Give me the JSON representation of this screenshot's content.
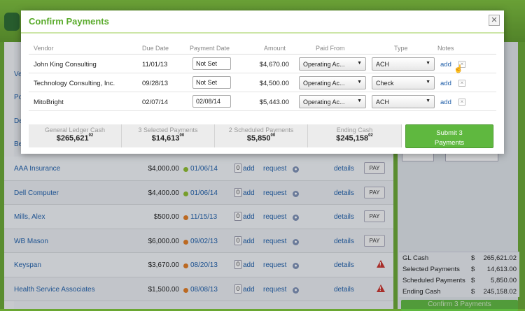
{
  "background": {
    "partial_vendors": [
      "Ve",
      "Po",
      "De",
      "Be"
    ],
    "rows": [
      {
        "vendor": "AAA Insurance",
        "amount": "$4,000.00",
        "status": "green",
        "date": "01/06/14",
        "count": "0",
        "add": "add",
        "request": "request",
        "details": "details",
        "action": "PAY"
      },
      {
        "vendor": "Dell Computer",
        "amount": "$4,400.00",
        "status": "green",
        "date": "01/06/14",
        "count": "0",
        "add": "add",
        "request": "request",
        "details": "details",
        "action": "PAY"
      },
      {
        "vendor": "Mills, Alex",
        "amount": "$500.00",
        "status": "orange",
        "date": "11/15/13",
        "count": "0",
        "add": "add",
        "request": "request",
        "details": "details",
        "action": "PAY"
      },
      {
        "vendor": "WB Mason",
        "amount": "$6,000.00",
        "status": "orange",
        "date": "09/02/13",
        "count": "0",
        "add": "add",
        "request": "request",
        "details": "details",
        "action": "PAY"
      },
      {
        "vendor": "Keyspan",
        "amount": "$3,670.00",
        "status": "orange",
        "date": "08/20/13",
        "count": "0",
        "add": "add",
        "request": "request",
        "details": "details",
        "action": "warning"
      },
      {
        "vendor": "Health Service Associates",
        "amount": "$1,500.00",
        "status": "orange",
        "date": "08/08/13",
        "count": "0",
        "add": "add",
        "request": "request",
        "details": "details",
        "action": "warning"
      }
    ],
    "totals": [
      {
        "label": "GL Cash",
        "currency": "$",
        "value": "265,621.02"
      },
      {
        "label": "Selected Payments",
        "currency": "$",
        "value": "14,613.00"
      },
      {
        "label": "Scheduled Payments",
        "currency": "$",
        "value": "5,850.00"
      },
      {
        "label": "Ending Cash",
        "currency": "$",
        "value": "245,158.02"
      }
    ],
    "confirm_label": "Confirm 3 Payments"
  },
  "modal": {
    "title": "Confirm Payments",
    "close": "✕",
    "headers": {
      "vendor": "Vendor",
      "due_date": "Due Date",
      "payment_date": "Payment Date",
      "amount": "Amount",
      "paid_from": "Paid From",
      "type": "Type",
      "notes": "Notes"
    },
    "rows": [
      {
        "vendor": "John King Consulting",
        "due_date": "11/01/13",
        "payment_date": "Not Set",
        "amount": "$4,670.00",
        "paid_from": "Operating Ac...",
        "type": "ACH",
        "note": "add"
      },
      {
        "vendor": "Technology Consulting, Inc.",
        "due_date": "09/28/13",
        "payment_date": "Not Set",
        "amount": "$4,500.00",
        "paid_from": "Operating Ac...",
        "type": "Check",
        "note": "add"
      },
      {
        "vendor": "MitoBright",
        "due_date": "02/07/14",
        "payment_date": "02/08/14",
        "amount": "$5,443.00",
        "paid_from": "Operating Ac...",
        "type": "ACH",
        "note": "add"
      }
    ],
    "summary": [
      {
        "label": "General Ledger Cash",
        "value": "$265,621",
        "cents": "02"
      },
      {
        "label": "3 Selected Payments",
        "value": "$14,613",
        "cents": "00"
      },
      {
        "label": "2 Scheduled Payments",
        "value": "$5,850",
        "cents": "00"
      },
      {
        "label": "Ending Cash",
        "value": "$245,158",
        "cents": "02"
      }
    ],
    "submit_line1": "Submit 3",
    "submit_line2": "Payments"
  },
  "colors": {
    "accent": "#5aab2c",
    "link": "#1f5ea8",
    "submit": "#5fb83f",
    "status_green": "#8dbb2d",
    "status_orange": "#e07b22",
    "warning": "#c8332b"
  },
  "icons": {
    "request": "person-icon",
    "warning": "warning-triangle-icon",
    "note_remove": "close-box-icon",
    "cursor": "hand-pointer-icon"
  }
}
